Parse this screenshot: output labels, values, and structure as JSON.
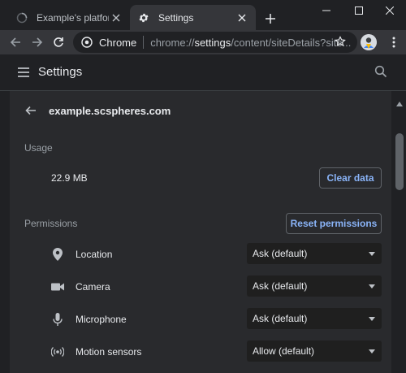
{
  "tabs": [
    {
      "label": "Example's platform",
      "active": false
    },
    {
      "label": "Settings",
      "active": true
    }
  ],
  "toolbar": {
    "site_chip": "Chrome",
    "url_scheme": "chrome://",
    "url_host": "settings",
    "url_path": "/content/siteDetails?site..."
  },
  "settings": {
    "title": "Settings"
  },
  "site": {
    "host": "example.scspheres.com"
  },
  "usage": {
    "label": "Usage",
    "value": "22.9 MB",
    "clear_label": "Clear data"
  },
  "permissions": {
    "label": "Permissions",
    "reset_label": "Reset permissions",
    "items": [
      {
        "label": "Location",
        "icon": "location-icon",
        "value": "Ask (default)"
      },
      {
        "label": "Camera",
        "icon": "camera-icon",
        "value": "Ask (default)"
      },
      {
        "label": "Microphone",
        "icon": "microphone-icon",
        "value": "Ask (default)"
      },
      {
        "label": "Motion sensors",
        "icon": "motion-sensors-icon",
        "value": "Allow (default)"
      }
    ]
  },
  "colors": {
    "background": "#202124",
    "card": "#292a2d",
    "accent": "#8ab4f8",
    "text": "#e8eaed",
    "muted": "#9aa0a6"
  }
}
